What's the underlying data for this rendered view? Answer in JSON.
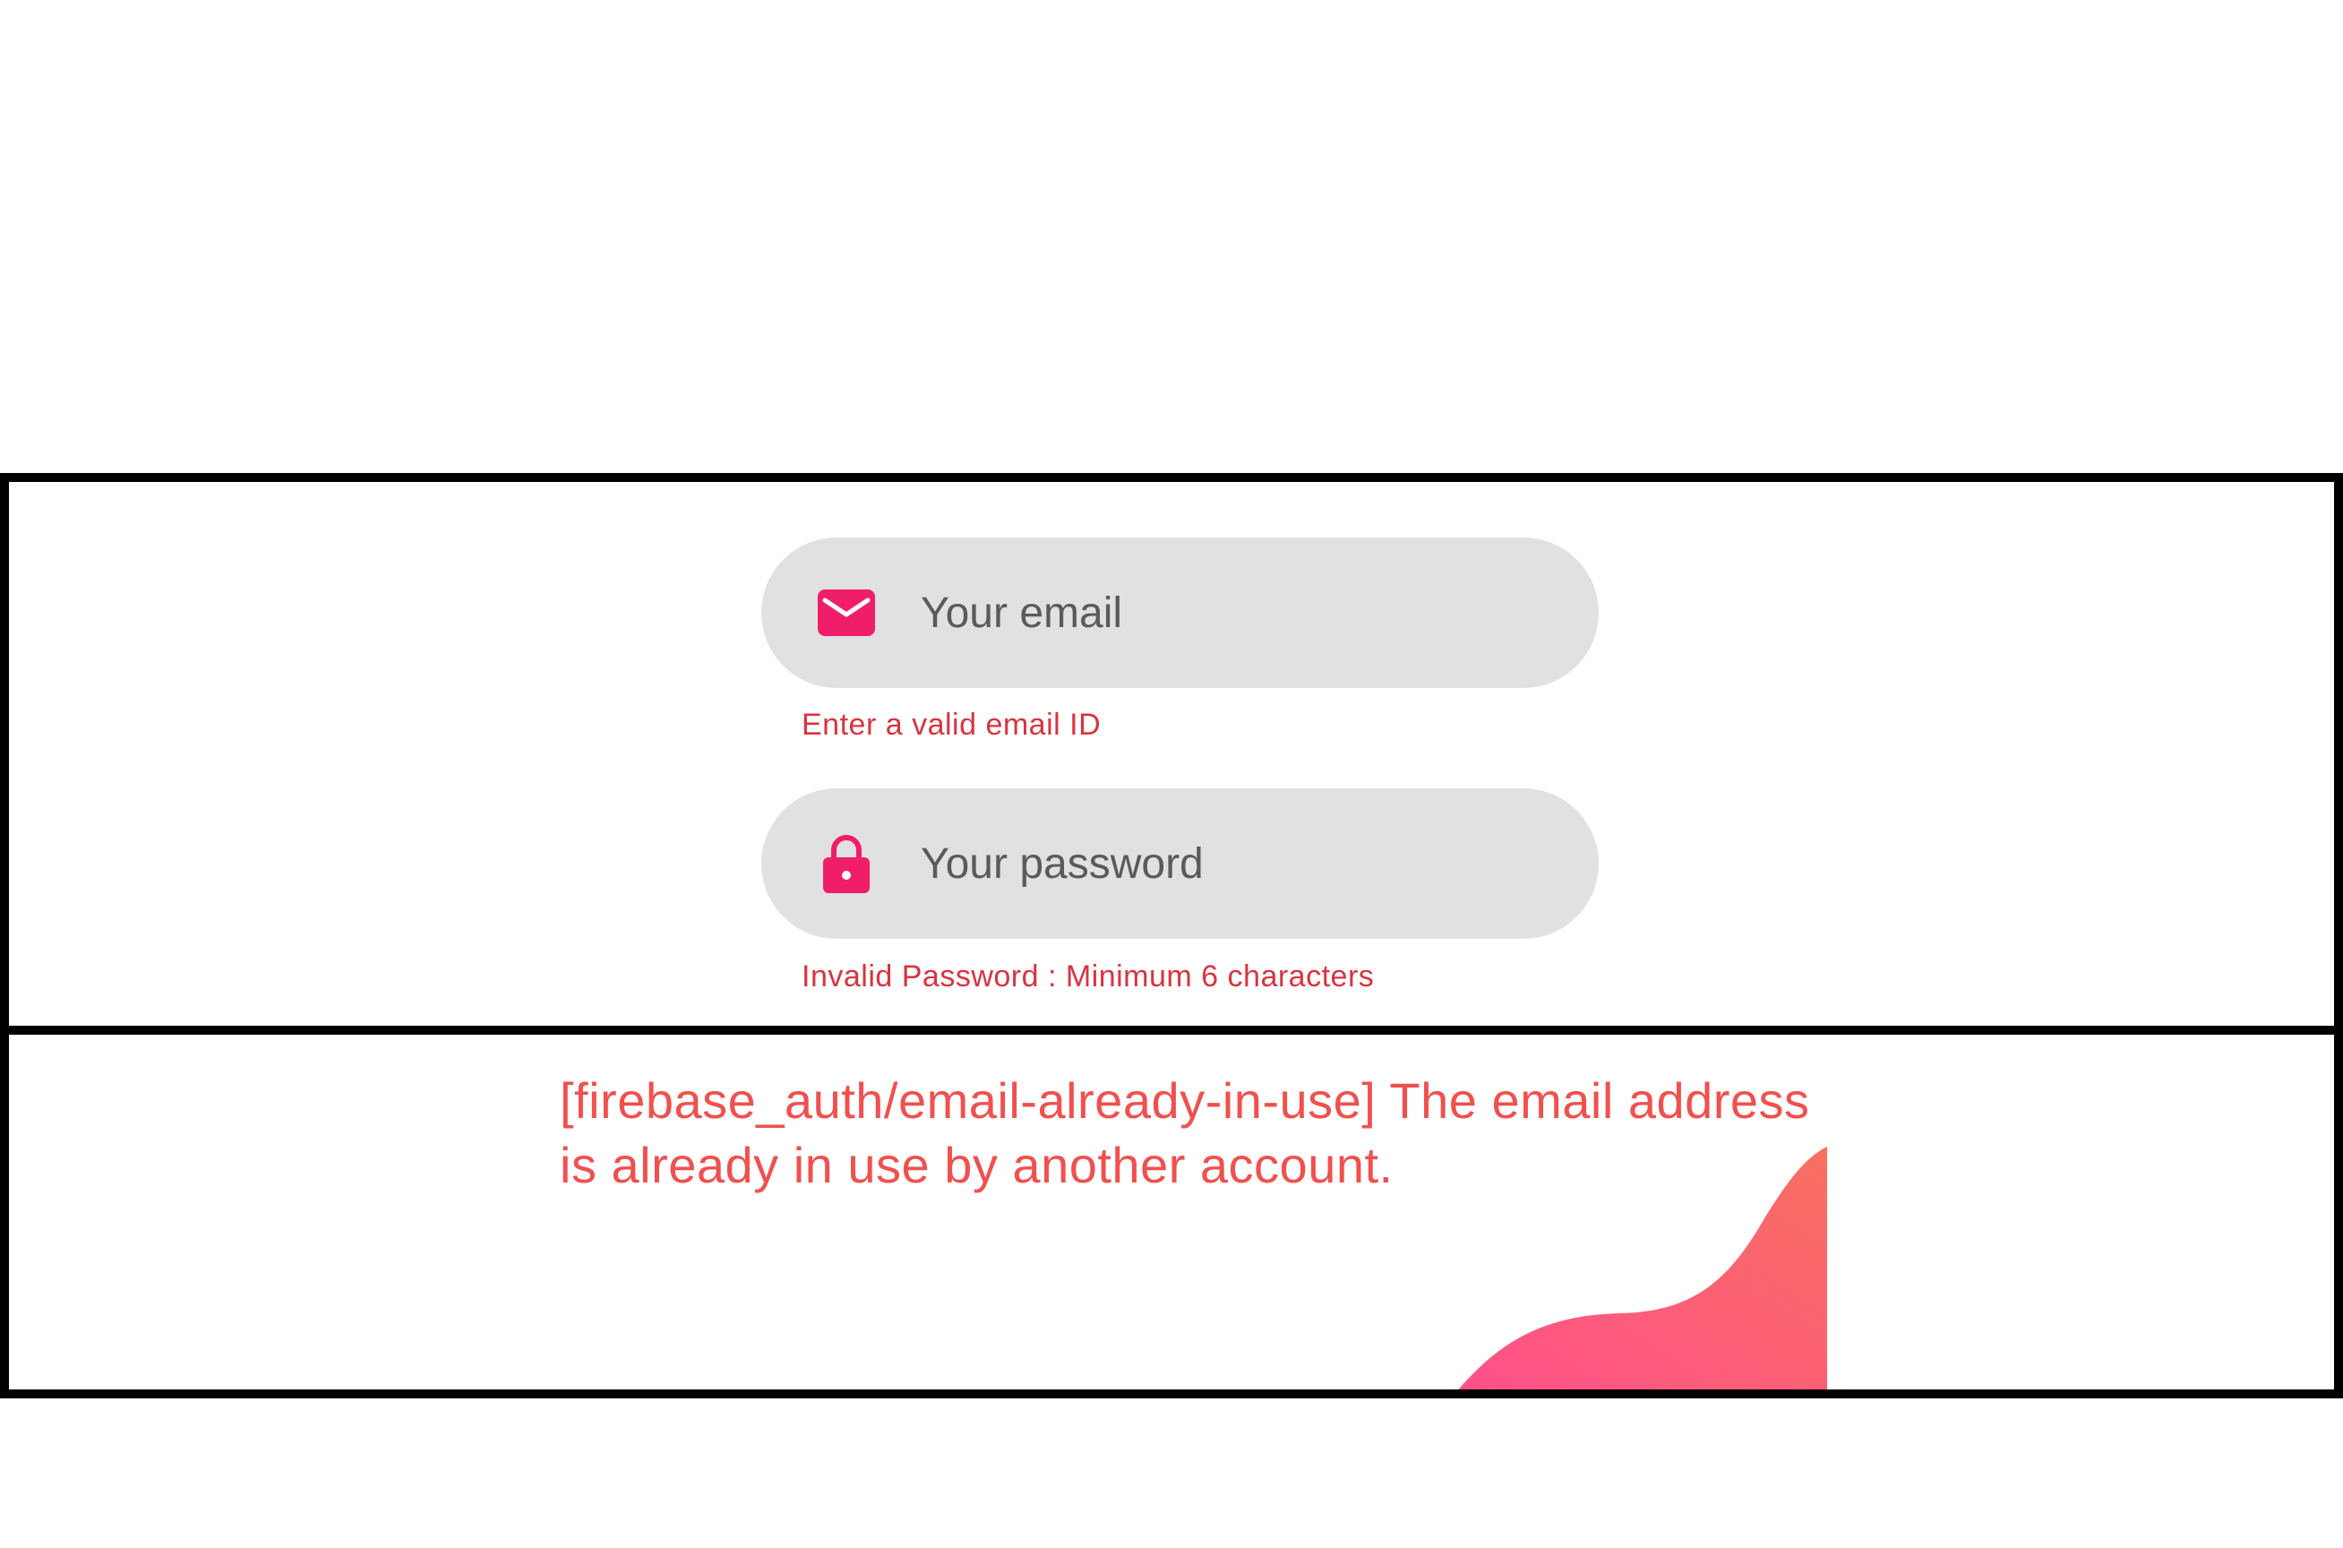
{
  "form": {
    "email": {
      "placeholder": "Your email",
      "value": "",
      "icon": "mail-icon",
      "error": "Enter a valid email ID"
    },
    "password": {
      "placeholder": "Your password",
      "value": "",
      "icon": "lock-icon",
      "error": "Invalid Password : Minimum 6 characters"
    }
  },
  "auth_error": {
    "message": "[firebase_auth/email-already-in-use] The email address is already in use by another account."
  },
  "colors": {
    "accent": "#f01e6a",
    "field_bg": "#e1e1e1",
    "helper_error": "#d9343f",
    "auth_error": "#f0504e",
    "wave_start": "#ff4f8b",
    "wave_end": "#f97060"
  }
}
